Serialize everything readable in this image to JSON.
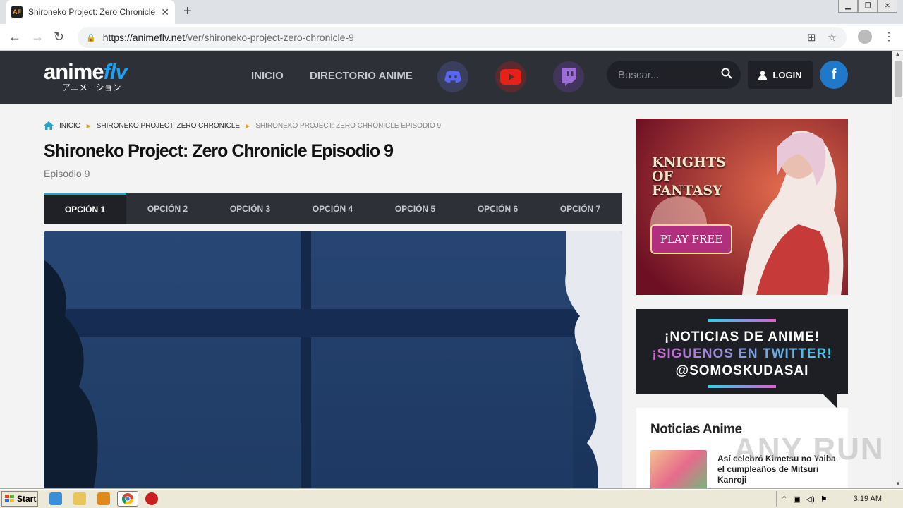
{
  "browser": {
    "tab_title": "Shironeko Project: Zero Chronicle Ep",
    "favicon_text": "AF",
    "url_host": "https://animeflv.net",
    "url_path": "/ver/shironeko-project-zero-chronicle-9",
    "new_tab": "+",
    "close": "✕"
  },
  "site": {
    "logo_main": "anime",
    "logo_accent": "flv",
    "logo_jp": "アニメーション",
    "nav": [
      "INICIO",
      "DIRECTORIO ANIME"
    ],
    "search_placeholder": "Buscar...",
    "login_label": "LOGIN",
    "facebook": "f"
  },
  "breadcrumb": [
    "INICIO",
    "SHIRONEKO PROJECT: ZERO CHRONICLE",
    "SHIRONEKO PROJECT: ZERO CHRONICLE EPISODIO 9"
  ],
  "episode": {
    "title": "Shironeko Project: Zero Chronicle Episodio 9",
    "subtitle": "Episodio 9"
  },
  "options": [
    "OPCIÓN 1",
    "OPCIÓN 2",
    "OPCIÓN 3",
    "OPCIÓN 4",
    "OPCIÓN 5",
    "OPCIÓN 6",
    "OPCIÓN 7"
  ],
  "ad": {
    "game_title": "KNIGHTS OF FANTASY",
    "cta": "PLAY FREE"
  },
  "twitter_banner": {
    "line1": "¡NOTICIAS DE ANIME!",
    "line2": "¡SIGUENOS EN TWITTER!",
    "line3": "@SOMOSKUDASAI"
  },
  "news": {
    "heading": "Noticias Anime",
    "items": [
      {
        "title": "Así celebró Kimetsu no Yaiba el cumpleaños de Mitsuri Kanroji"
      }
    ]
  },
  "watermark": "ANY RUN",
  "taskbar": {
    "start": "Start",
    "clock": "3:19 AM"
  },
  "colors": {
    "header_bg": "#2d3037",
    "accent_blue": "#1da1f2",
    "active_tab_border": "#26a3c9",
    "discord": "#5865f2",
    "youtube": "#e62117",
    "twitch": "#6441a5",
    "facebook": "#2079c8"
  }
}
